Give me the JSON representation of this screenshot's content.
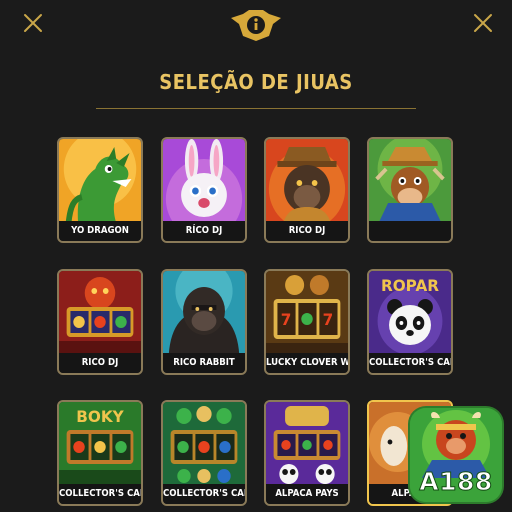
{
  "header": {
    "title": "SELEÇÃO DE JIUAS",
    "icons": [
      "close-icon",
      "info-badge-icon",
      "close-icon"
    ]
  },
  "games": [
    {
      "label": "YO DRAGON",
      "art": "dragon"
    },
    {
      "label": "RÍCO DJ",
      "art": "rabbit"
    },
    {
      "label": "RICO DJ",
      "art": "ape-hat"
    },
    {
      "label": "",
      "art": "cow-miner"
    },
    {
      "label": "RICO DJ",
      "art": "slot-red"
    },
    {
      "label": "RICO RABBIT",
      "art": "gorilla"
    },
    {
      "label": "LUCKY CLOVER WILD",
      "art": "slot-gold"
    },
    {
      "label": "COLLECTOR'S CARD",
      "art": "panda-ropar"
    },
    {
      "label": "COLLECTOR'S CARD",
      "art": "slot-boky"
    },
    {
      "label": "COLLECTOR'S CARD",
      "art": "slot-gems"
    },
    {
      "label": "ALPACA PAYS",
      "art": "slot-lucky-panda"
    },
    {
      "label": "ALPACA",
      "art": "alpaca"
    }
  ],
  "promo": {
    "brand": "A188"
  },
  "colors": {
    "accent": "#e9c463",
    "background": "#1b1b1b",
    "card_border": "#8a7a58"
  }
}
